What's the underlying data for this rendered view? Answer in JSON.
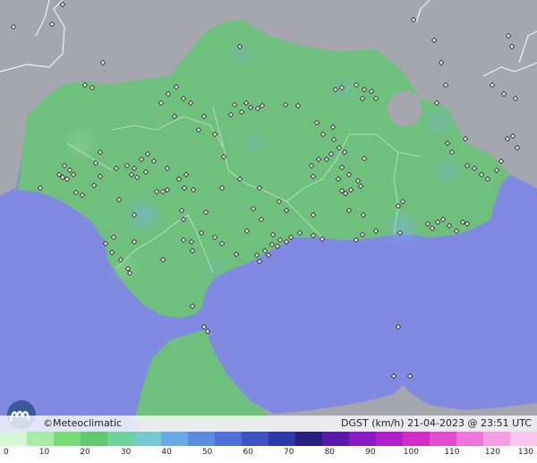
{
  "branding": {
    "name": "Meteoclimatic",
    "copyright": "©"
  },
  "status": {
    "variable": "DGST (km/h)",
    "datetime": "21-04-2023 @ 23:51 UTC"
  },
  "legend": {
    "ticks": [
      "0",
      "10",
      "20",
      "30",
      "40",
      "50",
      "60",
      "70",
      "80",
      "90",
      "100",
      "110",
      "120",
      "130"
    ],
    "colors": [
      "#d6f7d6",
      "#a6eba6",
      "#78dc78",
      "#5fca6f",
      "#6ed39a",
      "#76c9d2",
      "#6aa9e8",
      "#5b8be0",
      "#4d6fd6",
      "#3d53c4",
      "#2b3aa6",
      "#27207f",
      "#5a1aa8",
      "#8a1ac6",
      "#b020c8",
      "#d02cc8",
      "#e34bd1",
      "#ef74dc",
      "#f49ee6",
      "#f9c6ef"
    ]
  },
  "colors": {
    "sea": "#7f8ae0",
    "land_other": "#a6a6ae",
    "region_land": "#6fc07c",
    "border_line": "#ffffff"
  },
  "map": {
    "region": "Andalucía",
    "layers": [
      "sea",
      "land",
      "region-fill",
      "province-borders",
      "stations"
    ]
  }
}
